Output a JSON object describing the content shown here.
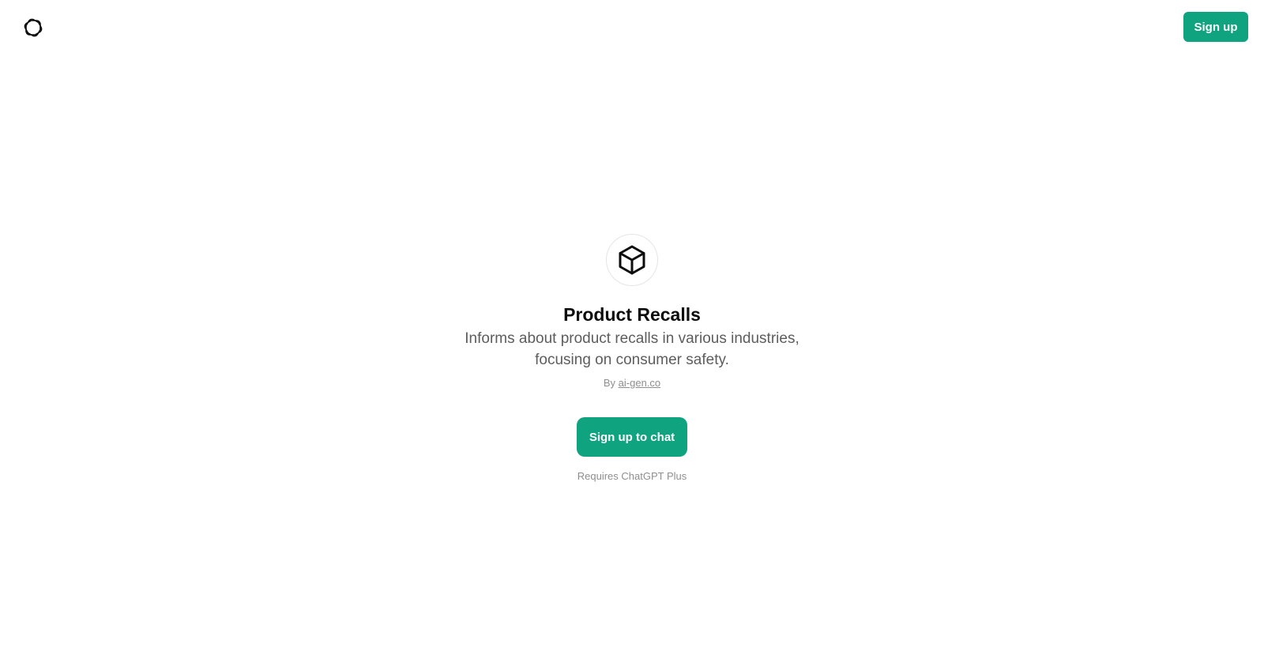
{
  "header": {
    "logo_icon": "openai-logo-icon",
    "signup_label": "Sign up",
    "accent_color": "#10a37f"
  },
  "gpt": {
    "icon": "cube-icon",
    "title": "Product Recalls",
    "description": "Informs about product recalls in various industries, focusing on consumer safety.",
    "by_prefix": "By",
    "author": "ai-gen.co",
    "cta_label": "Sign up to chat",
    "requirement": "Requires ChatGPT Plus"
  }
}
